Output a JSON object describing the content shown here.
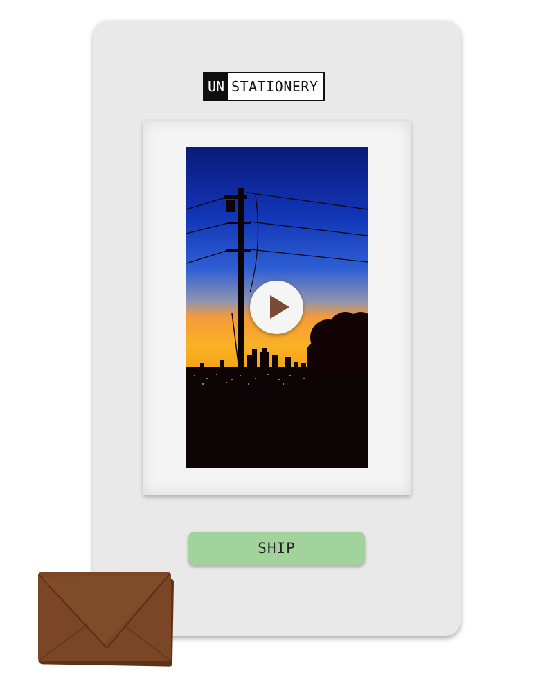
{
  "brand": {
    "prefix": "UN",
    "name": "STATIONERY"
  },
  "card": {
    "photo_icon": "sunset-city-skyline-power-pole-photo",
    "play_icon": "play-icon"
  },
  "actions": {
    "ship_label": "SHIP"
  },
  "decor": {
    "envelope_icon": "envelope-icon"
  },
  "colors": {
    "card_bg": "#e9e9e9",
    "ship_button": "#a3d39c",
    "envelope": "#7b4625",
    "play_triangle": "#7a4b34"
  }
}
